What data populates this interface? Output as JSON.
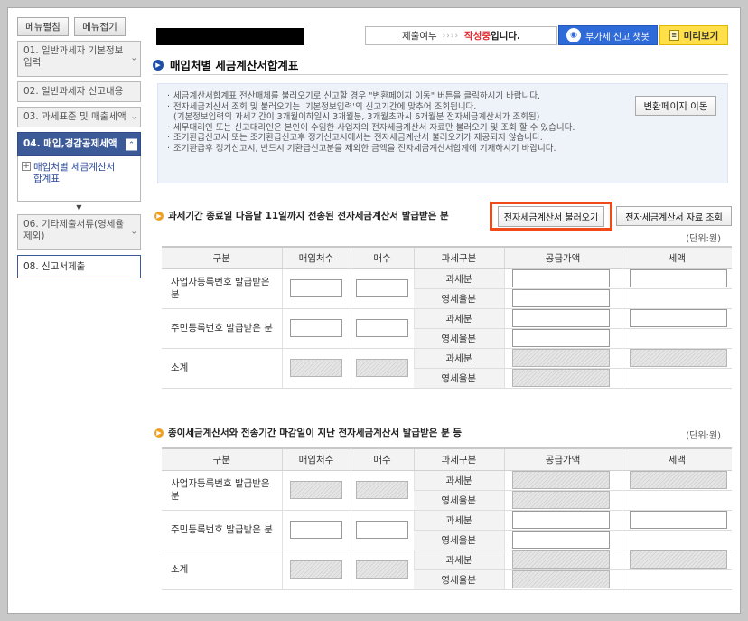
{
  "sidebar": {
    "expand_all": "메뉴펼침",
    "collapse_all": "메뉴접기",
    "items": [
      {
        "label": "01. 일반과세자 기본정보입력"
      },
      {
        "label": "02. 일반과세자 신고내용"
      },
      {
        "label": "03. 과세표준 및 매출세액"
      },
      {
        "label": "04. 매입,경감공제세액"
      },
      {
        "label": "06. 기타제출서류(영세율제외)"
      },
      {
        "label": "08. 신고서제출"
      }
    ],
    "sub_item": "매입처별 세금계산서 합계표"
  },
  "status": {
    "label": "제출여부",
    "arrows": "››››",
    "state": "작성중",
    "suffix": "입니다."
  },
  "chatbot_label": "부가세 신고 챗봇",
  "preview_label": "미리보기",
  "page_title": "매입처별 세금계산서합계표",
  "notice": [
    "세금계산서합계표 전산매체를 불러오기로 신고할 경우 \"변환페이지 이동\" 버튼을 클릭하시기 바랍니다.",
    "전자세금계산서 조회 및 불러오기는 '기본정보입력'의 신고기간에 맞추어 조회됩니다.",
    "(기본정보입력의 과세기간이 3개월이하일시 3개월분, 3개월초과시 6개월분 전자세금계산서가 조회됨)",
    "세무대리인 또는 신고대리인은 본인이 수임한 사업자의 전자세금계산서 자료만 불러오기 및 조회 할 수 있습니다.",
    "조기환급신고시 또는 조기환급신고후 정기신고시에서는 전자세금계산서 불러오기가 제공되지 않습니다.",
    "조기환급후 정기신고시, 반드시 기환급신고분을 제외한 금액을 전자세금계산서합계에 기재하시기 바랍니다."
  ],
  "change_page_button": "변환페이지 이동",
  "section1": {
    "title": "과세기간 종료일 다음달 11일까지 전송된 전자세금계산서 발급받은 분",
    "load_button": "전자세금계산서 불러오기",
    "lookup_button": "전자세금계산서 자료 조회",
    "unit": "(단위:원)"
  },
  "section2": {
    "title": "종이세금계산서와 전송기간 마감일이 지난 전자세금계산서 발급받은 분 등",
    "unit": "(단위:원)"
  },
  "table_headers": [
    "구분",
    "매입처수",
    "매수",
    "과세구분",
    "공급가액",
    "세액"
  ],
  "row_labels": {
    "business": "사업자등록번호 발급받은 분",
    "resident": "주민등록번호 발급받은 분",
    "subtotal": "소계"
  },
  "sub_labels": {
    "taxable": "과세분",
    "zero_rated": "영세율분"
  }
}
